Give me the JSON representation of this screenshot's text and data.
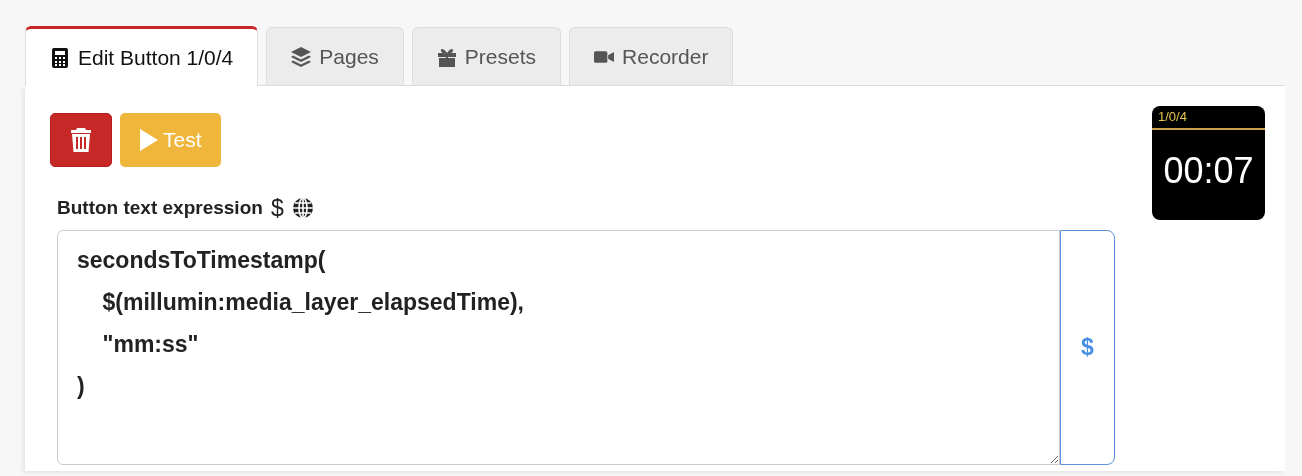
{
  "tabs": [
    {
      "label": "Edit Button 1/0/4",
      "kind": "editor",
      "selected": true
    },
    {
      "label": "Pages",
      "kind": "pages",
      "selected": false
    },
    {
      "label": "Presets",
      "kind": "presets",
      "selected": false
    },
    {
      "label": "Recorder",
      "kind": "recorder",
      "selected": false
    }
  ],
  "toolbar": {
    "test_label": "Test"
  },
  "expression": {
    "label": "Button text expression",
    "label_symbol": "$",
    "value": "secondsToTimestamp(\n    $(millumin:media_layer_elapsedTime),\n    \"mm:ss\"\n)",
    "addon": "$"
  },
  "preview": {
    "location": "1/0/4",
    "text": "00:07"
  }
}
